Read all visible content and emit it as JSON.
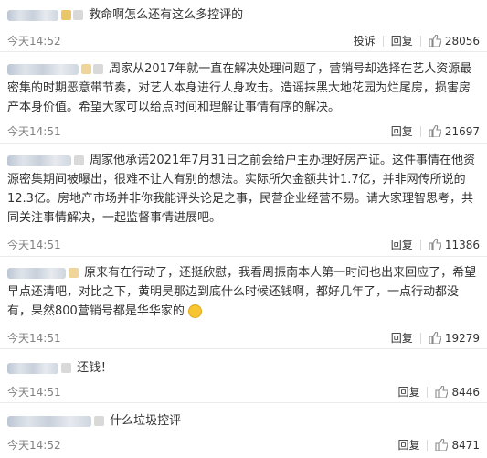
{
  "comments": [
    {
      "text": "救命啊怎么还有这么多控评的",
      "time": "今天14:52",
      "report": "投诉",
      "reply": "回复",
      "likes": "28056"
    },
    {
      "text": "周家从2017年就一直在解决处理问题了，营销号却选择在艺人资源最密集的时期恶意带节奏，对艺人本身进行人身攻击。造谣抹黑大地花园为烂尾房，损害房产本身价值。希望大家可以给点时间和理解让事情有序的解决。",
      "time": "今天14:51",
      "reply": "回复",
      "likes": "21697"
    },
    {
      "text": "周家他承诺2021年7月31日之前会给户主办理好房产证。这件事情在他资源密集期间被曝出，很难不让人有别的想法。实际所欠金额共计1.7亿，并非网传所说的12.3亿。房地产市场并非你我能评头论足之事，民营企业经营不易。请大家理智思考，共同关注事情解决，一起监督事情进展吧。",
      "time": "今天14:51",
      "reply": "回复",
      "likes": "11386"
    },
    {
      "text": "原来有在行动了，还挺欣慰，我看周振南本人第一时间也出来回应了，希望早点还清吧，对比之下，黄明昊那边到底什么时候还钱啊，都好几年了，一点行动都没有，果然800营销号都是华华家的",
      "time": "今天14:51",
      "reply": "回复",
      "likes": "19279"
    },
    {
      "text": "还钱！",
      "time": "今天14:51",
      "reply": "回复",
      "likes": "8446"
    },
    {
      "text": "什么垃圾控评",
      "time": "今天14:52",
      "reply": "回复",
      "likes": "8471"
    }
  ],
  "icons": {
    "like": "thumbs-up-icon",
    "emoji": "smile-emoji-icon"
  }
}
